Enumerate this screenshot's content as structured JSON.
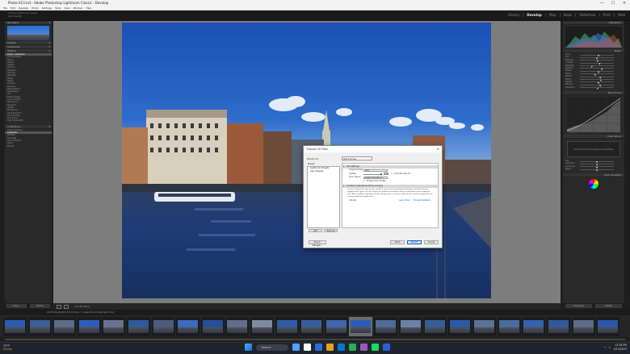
{
  "window": {
    "title": "Photo-V2.lrcat - Adobe Photoshop Lightroom Classic - Develop",
    "controls": [
      "—",
      "☐",
      "✕"
    ]
  },
  "menu": [
    "File",
    "Edit",
    "Develop",
    "Photo",
    "Settings",
    "Tools",
    "View",
    "Window",
    "Help"
  ],
  "identity": {
    "line1": "Adobe Lightroom Classic",
    "line2": "Get Started"
  },
  "modules": [
    {
      "label": "Library",
      "active": false
    },
    {
      "label": "Develop",
      "active": true
    },
    {
      "label": "Map",
      "active": false
    },
    {
      "label": "Book",
      "active": false
    },
    {
      "label": "Slideshow",
      "active": false
    },
    {
      "label": "Print",
      "active": false
    },
    {
      "label": "Web",
      "active": false
    }
  ],
  "left_panel": {
    "navigator": "Navigator",
    "presets": "Presets",
    "snapshots": "Snapshots",
    "history": "History",
    "history_items": [
      "Export - Amsterdam",
      "Crop Rectangle",
      "Clarity",
      "Texture",
      "Dehaze",
      "Vibrance",
      "Saturation",
      "Shadows",
      "Highlights",
      "Whites",
      "Blacks",
      "Contrast",
      "Exposure",
      "White Balance",
      "Temperature",
      "Tint",
      "Profile Change",
      "Lens Correction",
      "Remove CA",
      "Transform",
      "Upright",
      "Sharpening",
      "Noise Reduction",
      "Color Grading",
      "Tone Curve",
      "Import (4/2/2023)"
    ],
    "collections": "Collections",
    "collection_items": [
      "Smart Collections",
      "Amsterdam",
      "Edit Sets",
      "Favourites",
      "Quick Collection",
      "Travel",
      "Exports"
    ],
    "copy_label": "Copy...",
    "paste_label": "Paste"
  },
  "right_panel": {
    "histogram": "Histogram",
    "basic": "Basic",
    "basic_sliders": [
      {
        "label": "Temp",
        "value": 0.55
      },
      {
        "label": "Tint",
        "value": 0.5
      },
      {
        "label": "Exposure",
        "value": 0.52
      },
      {
        "label": "Contrast",
        "value": 0.58
      },
      {
        "label": "Highlights",
        "value": 0.35
      },
      {
        "label": "Shadows",
        "value": 0.65
      },
      {
        "label": "Whites",
        "value": 0.55
      },
      {
        "label": "Blacks",
        "value": 0.45
      },
      {
        "label": "Texture",
        "value": 0.6
      },
      {
        "label": "Clarity",
        "value": 0.62
      },
      {
        "label": "Dehaze",
        "value": 0.55
      },
      {
        "label": "Vibrance",
        "value": 0.6
      },
      {
        "label": "Saturation",
        "value": 0.52
      }
    ],
    "tone_curve": "Tone Curve",
    "color_mixer": "Color Mixer",
    "color_hint": "Use the Point Color Dropper to add swatches",
    "color_sliders": [
      {
        "label": "Hue",
        "value": 0.5
      },
      {
        "label": "Saturation",
        "value": 0.5
      },
      {
        "label": "Luminance",
        "value": 0.5
      },
      {
        "label": "Range",
        "value": 0.5
      }
    ],
    "color_grading": "Color Grading",
    "previous_label": "Previous",
    "reset_label": "Reset"
  },
  "toolbar": {
    "text": "Soft Proofing"
  },
  "sourcebar": {
    "text": "All Photographs   43 photos / 1 selected   Amsterdam.dng"
  },
  "filmstrip": {
    "selected_index": 14,
    "thumbs": [
      "#2a5cb0",
      "#3a5f9a",
      "#5a6e8a",
      "#2e5fb8",
      "#6a7390",
      "#305a9e",
      "#4a5d80",
      "#3b6bc0",
      "#264f99",
      "#5d6f8c",
      "#7c8ba3",
      "#2f5ca8",
      "#375f9f",
      "#3c66b0",
      "#2c5db6",
      "#4d6d9a",
      "#6a82a8",
      "#345f9c",
      "#2b5aa8",
      "#5a7398",
      "#476c9f",
      "#3563b2",
      "#2f5a9a",
      "#5b6d8a",
      "#2958ad"
    ]
  },
  "dialog": {
    "title": "Export 20 Files",
    "export_to_label": "Export To:",
    "export_to_value": "Hard Drive",
    "preset_label": "Preset:",
    "presets": [
      "Lightroom Presets",
      "User Presets"
    ],
    "add_label": "Add",
    "remove_label": "Remove",
    "section_file": "File Settings",
    "image_format_label": "Image Format:",
    "image_format_value": "JPEG",
    "quality_label": "Quality:",
    "quality_value": "100",
    "limit_label": "Limit File Size To:",
    "color_space_label": "Color Space:",
    "color_space_value": "sRGB IEC61966-2.1",
    "embed_label": "Embed Color Profile",
    "section_credentials": "Content Credentials (Early Access)",
    "credentials_text": "Content Credentials help you get credit for your work by attaching attribution and edit history to supported file types. You can choose the producer and apply content credentials to your exported files. When enabled, Lightroom Classic will generate a content credential file. Content credentials are recommended for images that ...",
    "include_label": "Include:",
    "learn_label": "Learn More",
    "vendor_label": "Provide Feedback",
    "plugin_label": "Plug-in Manager...",
    "done_label": "Done",
    "export_label": "Export",
    "cancel_label": "Cancel"
  },
  "taskbar": {
    "weather_temp": "75°F",
    "weather_desc": "Sunny",
    "search_label": "Search",
    "time": "12:18 PM",
    "date": "4/15/2023",
    "icon_colors": [
      "#4aa3ff",
      "#ffffff",
      "#2a6fd6",
      "#e8a020",
      "#0078d4",
      "#27ae60",
      "#9b59b6",
      "#1ed760",
      "#2b5dd8"
    ]
  },
  "colors": {
    "accent": "#0a64c8",
    "panel": "#2a2a2a",
    "canvas": "#7d7d7d"
  }
}
